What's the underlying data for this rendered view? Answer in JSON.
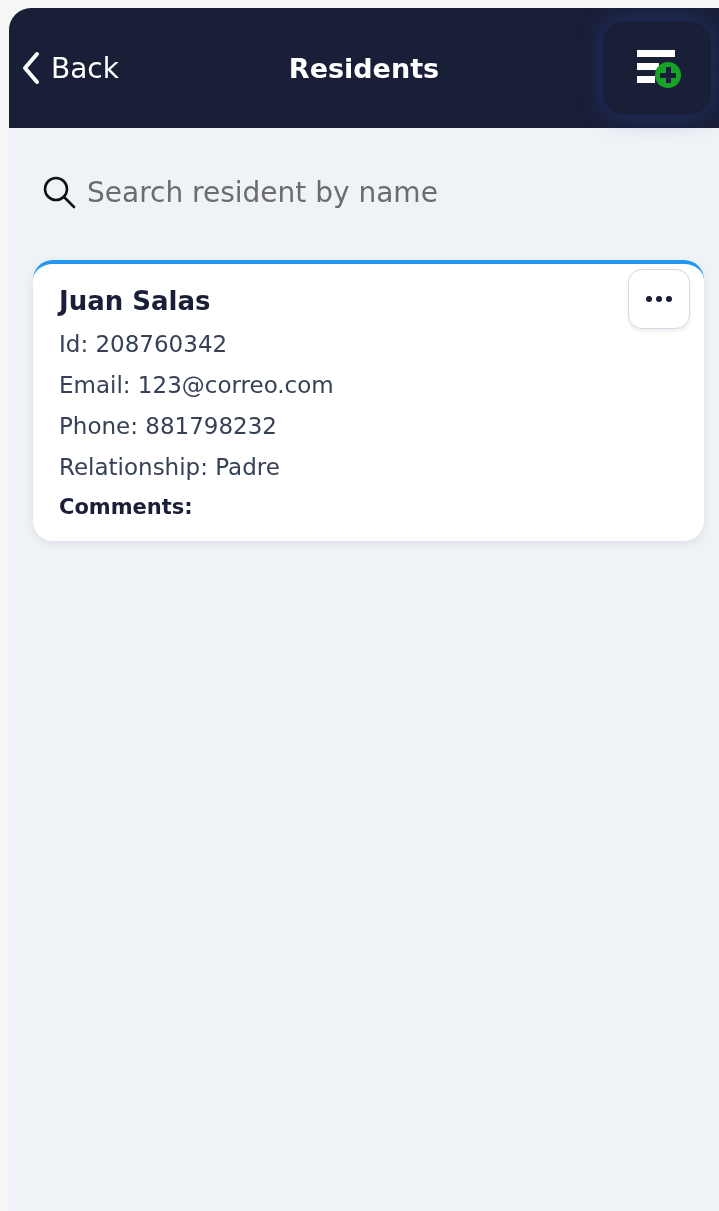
{
  "header": {
    "back": "Back",
    "title": "Residents"
  },
  "search": {
    "placeholder": "Search resident by name"
  },
  "residents": [
    {
      "name": "Juan Salas",
      "lines": [
        "Id: 208760342",
        "Email: 123@correo.com",
        "Phone: 881798232",
        "Relationship: Padre"
      ],
      "comments": "Comments:"
    }
  ]
}
